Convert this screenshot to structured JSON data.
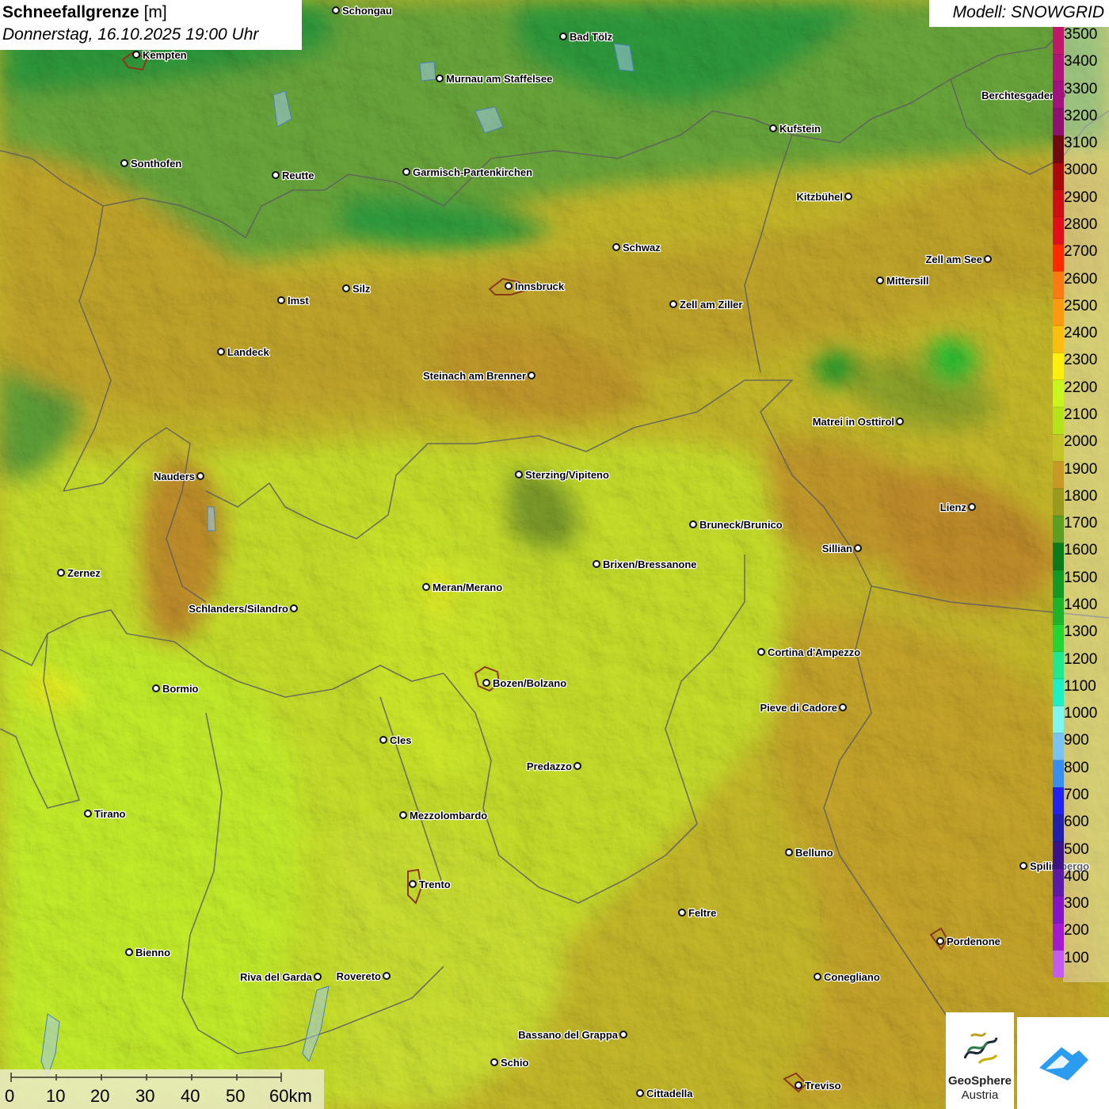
{
  "title": {
    "variable": "Schneefallgrenze",
    "unit": "[m]",
    "datetime": "Donnerstag, 16.10.2025 19:00 Uhr"
  },
  "model_label": "Modell: SNOWGRID",
  "legend": {
    "levels": [
      "3500",
      "3400",
      "3300",
      "3200",
      "3100",
      "3000",
      "2900",
      "2800",
      "2700",
      "2600",
      "2500",
      "2400",
      "2300",
      "2200",
      "2100",
      "2000",
      "1900",
      "1800",
      "1700",
      "1600",
      "1500",
      "1400",
      "1300",
      "1200",
      "1100",
      "1000",
      "900",
      "800",
      "700",
      "600",
      "500",
      "400",
      "300",
      "200",
      "100"
    ],
    "colors": [
      "#c0186b",
      "#b0167a",
      "#a0137f",
      "#8f1070",
      "#6e0a10",
      "#a80a0a",
      "#cc0f12",
      "#e0101a",
      "#ff2a00",
      "#f77a12",
      "#fa9a10",
      "#fcbf10",
      "#fbef0e",
      "#c9f51e",
      "#b6e21a",
      "#c4c32a",
      "#c79a26",
      "#9a9a1e",
      "#5e9e22",
      "#0d7a1a",
      "#149a24",
      "#1fb22a",
      "#28d434",
      "#22e88c",
      "#1cf0c4",
      "#80f6f0",
      "#7ac4f2",
      "#3a8ef0",
      "#2222f0",
      "#2020a8",
      "#3a1486",
      "#5c1aa6",
      "#8414c8",
      "#a41ad2",
      "#c45cf0"
    ]
  },
  "scale_bar": {
    "labels": [
      "0",
      "10",
      "20",
      "30",
      "40",
      "50",
      "60km"
    ]
  },
  "places": [
    {
      "name": "Schongau",
      "label_side": "right"
    },
    {
      "name": "Bad Tölz",
      "label_side": "right"
    },
    {
      "name": "Kempten",
      "label_side": "right"
    },
    {
      "name": "Murnau am Staffelsee",
      "label_side": "right"
    },
    {
      "name": "Berchtesgaden",
      "label_side": "left"
    },
    {
      "name": "Kufstein",
      "label_side": "right"
    },
    {
      "name": "Sonthofen",
      "label_side": "right"
    },
    {
      "name": "Reutte",
      "label_side": "right"
    },
    {
      "name": "Garmisch-Partenkirchen",
      "label_side": "right"
    },
    {
      "name": "Kitzbühel",
      "label_side": "left"
    },
    {
      "name": "Schwaz",
      "label_side": "right"
    },
    {
      "name": "Zell am See",
      "label_side": "left"
    },
    {
      "name": "Innsbruck",
      "label_side": "right"
    },
    {
      "name": "Mittersill",
      "label_side": "right"
    },
    {
      "name": "Imst",
      "label_side": "right"
    },
    {
      "name": "Silz",
      "label_side": "right"
    },
    {
      "name": "Zell am Ziller",
      "label_side": "right"
    },
    {
      "name": "Landeck",
      "label_side": "right"
    },
    {
      "name": "Steinach am Brenner",
      "label_side": "left"
    },
    {
      "name": "Matrei in Osttirol",
      "label_side": "left"
    },
    {
      "name": "Nauders",
      "label_side": "left"
    },
    {
      "name": "Sterzing/Vipiteno",
      "label_side": "right"
    },
    {
      "name": "Lienz",
      "label_side": "left"
    },
    {
      "name": "Bruneck/Brunico",
      "label_side": "right"
    },
    {
      "name": "Sillian",
      "label_side": "left"
    },
    {
      "name": "Zernez",
      "label_side": "right"
    },
    {
      "name": "Brixen/Bressanone",
      "label_side": "right"
    },
    {
      "name": "Meran/Merano",
      "label_side": "right"
    },
    {
      "name": "Schlanders/Silandro",
      "label_side": "left"
    },
    {
      "name": "Cortina d'Ampezzo",
      "label_side": "right"
    },
    {
      "name": "Bozen/Bolzano",
      "label_side": "right"
    },
    {
      "name": "Bormio",
      "label_side": "right"
    },
    {
      "name": "Pieve di Cadore",
      "label_side": "left"
    },
    {
      "name": "Cles",
      "label_side": "right"
    },
    {
      "name": "Predazzo",
      "label_side": "left"
    },
    {
      "name": "Tirano",
      "label_side": "right"
    },
    {
      "name": "Mezzolombardo",
      "label_side": "right"
    },
    {
      "name": "Belluno",
      "label_side": "right"
    },
    {
      "name": "Trento",
      "label_side": "right"
    },
    {
      "name": "Feltre",
      "label_side": "right"
    },
    {
      "name": "Pordenone",
      "label_side": "right"
    },
    {
      "name": "Bienno",
      "label_side": "right"
    },
    {
      "name": "Riva del Garda",
      "label_side": "left"
    },
    {
      "name": "Rovereto",
      "label_side": "left"
    },
    {
      "name": "Conegliano",
      "label_side": "right"
    },
    {
      "name": "Bassano del Grappa",
      "label_side": "left"
    },
    {
      "name": "Schio",
      "label_side": "right"
    },
    {
      "name": "Treviso",
      "label_side": "right"
    },
    {
      "name": "Cittadella",
      "label_side": "right"
    },
    {
      "name": "Spilimbergo",
      "label_side": "right"
    }
  ],
  "logos": {
    "geosphere_line1": "GeoSphere",
    "geosphere_line2": "Austria"
  }
}
